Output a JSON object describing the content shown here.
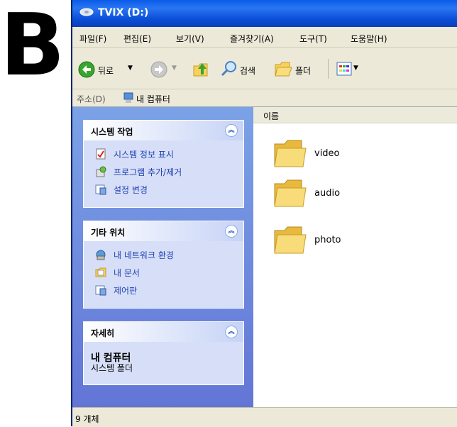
{
  "overlay_letter": "B",
  "window": {
    "title": "TVIX (D:)"
  },
  "menu": [
    "파일(F)",
    "편집(E)",
    "보기(V)",
    "즐겨찾기(A)",
    "도구(T)",
    "도움말(H)"
  ],
  "toolbar": {
    "back_label": "뒤로",
    "search_label": "검색",
    "folders_label": "폴더"
  },
  "address": {
    "label": "주소(D)",
    "value": "내 컴퓨터"
  },
  "panels": {
    "system_tasks": {
      "title": "시스템 작업",
      "items": [
        "시스템 정보 표시",
        "프로그램 추가/제거",
        "설정 변경"
      ]
    },
    "other_places": {
      "title": "기타 위치",
      "items": [
        "내 네트워크 환경",
        "내 문서",
        "제어판"
      ]
    },
    "details": {
      "title": "자세히",
      "name": "내 컴퓨터",
      "type": "시스템 폴더"
    }
  },
  "content": {
    "column_name": "이름",
    "folders": [
      "video",
      "audio",
      "photo"
    ]
  },
  "status": {
    "text": "9 개체"
  },
  "colors": {
    "titlebar": "#0a5be8",
    "taskpane_bg": "#6f8fde",
    "panel_bg": "#d6dff7",
    "folder_yellow": "#f6d160"
  }
}
